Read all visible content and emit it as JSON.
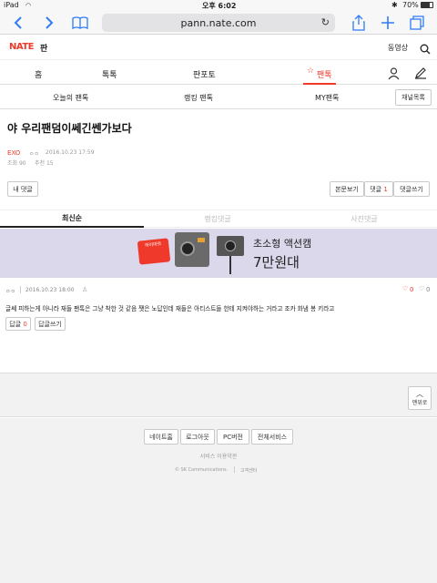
{
  "status": {
    "carrier": "iPad",
    "time": "오후 6:02",
    "battery": "70%"
  },
  "browser": {
    "url": "pann.nate.com"
  },
  "header": {
    "logo": "NATE",
    "logo_sub": "판",
    "video": "동영상"
  },
  "gnb": {
    "items": [
      "홈",
      "톡톡",
      "판포토",
      "팬톡"
    ]
  },
  "subnav": {
    "items": [
      "오늘의 팬톡",
      "랭킹 팬톡",
      "MY팬톡"
    ],
    "channel_button": "채널목록"
  },
  "post": {
    "title": "야 우리팬덤이쎄긴쎈가보다",
    "category": "EXO",
    "author": "ㅇㅇ",
    "date": "2016.10.23 17:59",
    "views": "조회 90",
    "recommend": "추천 15"
  },
  "actions": {
    "my_comments": "내 댓글",
    "view_post": "본문보기",
    "comments_label": "댓글",
    "comments_count": "1",
    "write_comment": "댓글쓰기"
  },
  "tabs": [
    "최신순",
    "랭킹댓글",
    "사진댓글"
  ],
  "ad": {
    "text1": "초소형 액션캠",
    "text2": "7만원대",
    "brand": "하이마트"
  },
  "comment": {
    "author": "ㅇㅇ",
    "date": "2016.10.23 18:00",
    "likes": "0",
    "dislikes": "0",
    "body": "글쎄 피하는게 아니라 재들 팬톡은 그냥 착한 것 같음 쨋은 노답인데 재들은 아티스트들 한테 지켜야하는 거라고 조카 화냄 봉 키라고",
    "reply_label": "답글",
    "reply_count": "0",
    "write_reply": "답글쓰기"
  },
  "top_button": "맨위로",
  "footer": {
    "links": [
      "네이트홈",
      "로그아웃",
      "PC버전",
      "전체서비스"
    ],
    "terms": "서비스 이용약관",
    "copyright": "© SK Communications.",
    "support": "고객센터"
  },
  "colors": {
    "brand": "#ef3a2b",
    "ios_blue": "#2f7cf6",
    "ad_bg": "#dcd8ec"
  }
}
